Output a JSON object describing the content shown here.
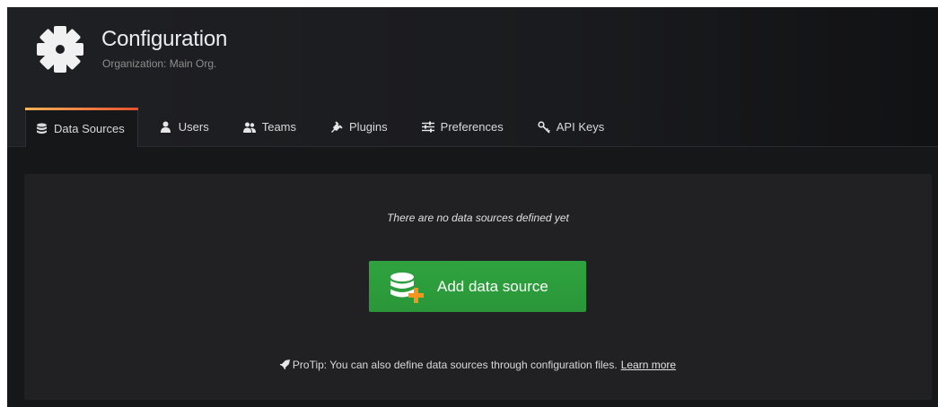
{
  "header": {
    "title": "Configuration",
    "subtitle": "Organization: Main Org.",
    "icon": "gear-icon"
  },
  "tabs": [
    {
      "label": "Data Sources",
      "icon": "database-icon",
      "active": true
    },
    {
      "label": "Users",
      "icon": "user-icon",
      "active": false
    },
    {
      "label": "Teams",
      "icon": "users-icon",
      "active": false
    },
    {
      "label": "Plugins",
      "icon": "plug-icon",
      "active": false
    },
    {
      "label": "Preferences",
      "icon": "sliders-icon",
      "active": false
    },
    {
      "label": "API Keys",
      "icon": "key-icon",
      "active": false
    }
  ],
  "main": {
    "empty_message": "There are no data sources defined yet",
    "add_button": {
      "label": "Add data source",
      "icon": "database-plus-icon"
    },
    "protip": {
      "text": "ProTip: You can also define data sources through configuration files.",
      "link_label": "Learn more",
      "icon": "rocket-icon"
    }
  },
  "colors": {
    "background": "#161719",
    "panel": "#212124",
    "button": "#2a9639",
    "tab_accent": "#ff7941",
    "plus": "#f7941e"
  }
}
